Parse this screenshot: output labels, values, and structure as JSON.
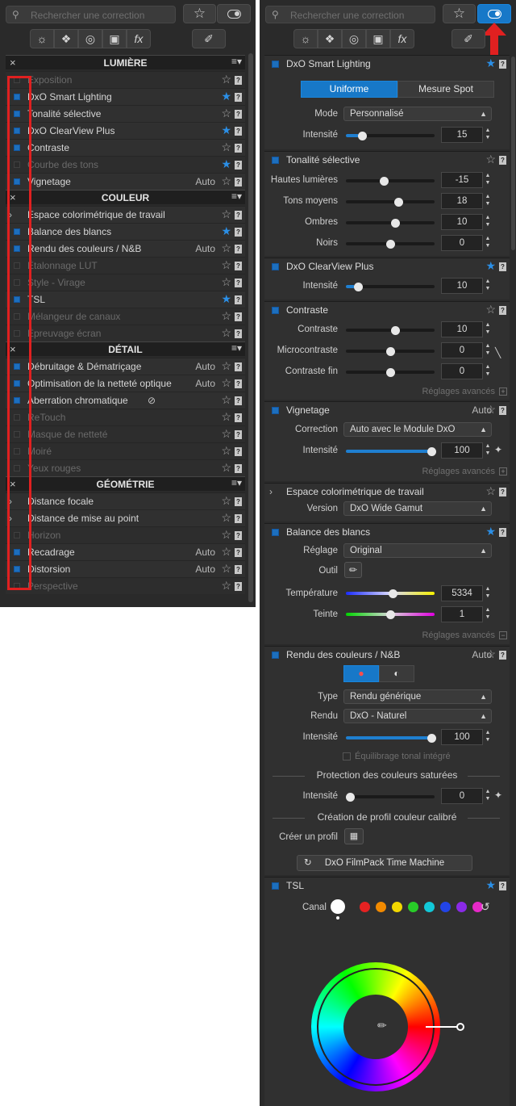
{
  "search": {
    "placeholder": "Rechercher une correction"
  },
  "left": {
    "sections": [
      {
        "title": "LUMIÈRE",
        "items": [
          {
            "label": "Exposition",
            "enabled": false,
            "star": false
          },
          {
            "label": "DxO Smart Lighting",
            "enabled": true,
            "star": true
          },
          {
            "label": "Tonalité sélective",
            "enabled": true,
            "star": false
          },
          {
            "label": "DxO ClearView Plus",
            "enabled": true,
            "star": true
          },
          {
            "label": "Contraste",
            "enabled": true,
            "star": false
          },
          {
            "label": "Courbe des tons",
            "enabled": false,
            "star": true
          },
          {
            "label": "Vignetage",
            "enabled": true,
            "star": false,
            "auto": "Auto"
          }
        ]
      },
      {
        "title": "COULEUR",
        "items": [
          {
            "label": "Espace colorimétrique de travail",
            "enabled": true,
            "star": false,
            "arrow": true
          },
          {
            "label": "Balance des blancs",
            "enabled": true,
            "star": true
          },
          {
            "label": "Rendu des couleurs / N&B",
            "enabled": true,
            "star": false,
            "auto": "Auto"
          },
          {
            "label": "Étalonnage LUT",
            "enabled": false,
            "star": false
          },
          {
            "label": "Style - Virage",
            "enabled": false,
            "star": false
          },
          {
            "label": "TSL",
            "enabled": true,
            "star": true
          },
          {
            "label": "Mélangeur de canaux",
            "enabled": false,
            "star": false
          },
          {
            "label": "Épreuvage écran",
            "enabled": false,
            "star": false
          }
        ]
      },
      {
        "title": "DÉTAIL",
        "items": [
          {
            "label": "Débruitage & Dématriçage",
            "enabled": true,
            "star": false,
            "auto": "Auto"
          },
          {
            "label": "Optimisation de la netteté optique",
            "enabled": true,
            "star": false,
            "auto": "Auto"
          },
          {
            "label": "Aberration chromatique",
            "enabled": true,
            "star": false,
            "eye": true
          },
          {
            "label": "ReTouch",
            "enabled": false,
            "star": false
          },
          {
            "label": "Masque de netteté",
            "enabled": false,
            "star": false
          },
          {
            "label": "Moiré",
            "enabled": false,
            "star": false
          },
          {
            "label": "Yeux rouges",
            "enabled": false,
            "star": false
          }
        ]
      },
      {
        "title": "GÉOMÉTRIE",
        "items": [
          {
            "label": "Distance focale",
            "enabled": true,
            "star": false,
            "arrow": true
          },
          {
            "label": "Distance de mise au point",
            "enabled": true,
            "star": false,
            "arrow": true
          },
          {
            "label": "Horizon",
            "enabled": false,
            "star": false
          },
          {
            "label": "Recadrage",
            "enabled": true,
            "star": false,
            "auto": "Auto"
          },
          {
            "label": "Distorsion",
            "enabled": true,
            "star": false,
            "auto": "Auto"
          },
          {
            "label": "Perspective",
            "enabled": false,
            "star": false
          }
        ]
      }
    ]
  },
  "toolbar": {
    "fx_label": "fx",
    "q_label": "?"
  },
  "right": {
    "smart_lighting": {
      "title": "DxO Smart Lighting",
      "seg_uniform": "Uniforme",
      "seg_spot": "Mesure Spot",
      "mode_label": "Mode",
      "mode_value": "Personnalisé",
      "intensity_label": "Intensité",
      "intensity_value": "15"
    },
    "tonal": {
      "title": "Tonalité sélective",
      "sliders": [
        {
          "label": "Hautes lumières",
          "value": "-15"
        },
        {
          "label": "Tons moyens",
          "value": "18"
        },
        {
          "label": "Ombres",
          "value": "10"
        },
        {
          "label": "Noirs",
          "value": "0"
        }
      ]
    },
    "clearview": {
      "title": "DxO ClearView Plus",
      "intensity_label": "Intensité",
      "intensity_value": "10"
    },
    "contrast": {
      "title": "Contraste",
      "sliders": [
        {
          "label": "Contraste",
          "value": "10"
        },
        {
          "label": "Microcontraste",
          "value": "0"
        },
        {
          "label": "Contraste fin",
          "value": "0"
        }
      ],
      "advanced": "Réglages avancés"
    },
    "vignetting": {
      "title": "Vignetage",
      "auto": "Auto",
      "correction_label": "Correction",
      "correction_value": "Auto avec le Module DxO",
      "intensity_label": "Intensité",
      "intensity_value": "100",
      "advanced": "Réglages avancés"
    },
    "colorspace": {
      "title": "Espace colorimétrique de travail",
      "version_label": "Version",
      "version_value": "DxO Wide Gamut"
    },
    "wb": {
      "title": "Balance des blancs",
      "setting_label": "Réglage",
      "setting_value": "Original",
      "tool_label": "Outil",
      "temp_label": "Température",
      "temp_value": "5334",
      "tint_label": "Teinte",
      "tint_value": "1",
      "advanced": "Réglages avancés"
    },
    "render": {
      "title": "Rendu des couleurs / N&B",
      "auto": "Auto",
      "type_label": "Type",
      "type_value": "Rendu générique",
      "render_label": "Rendu",
      "render_value": "DxO - Naturel",
      "intensity_label": "Intensité",
      "intensity_value": "100",
      "tonal_balance": "Équilibrage tonal intégré",
      "protection_title": "Protection des couleurs saturées",
      "protection_intensity_label": "Intensité",
      "protection_intensity_value": "0",
      "profile_title": "Création de profil couleur calibré",
      "create_profile_label": "Créer un profil",
      "filmpack_label": "DxO FilmPack Time Machine"
    },
    "hsl": {
      "title": "TSL",
      "channel_label": "Canal",
      "channels": [
        "#ffffff",
        "#e52222",
        "#f28a00",
        "#f2d800",
        "#28cc28",
        "#12c8d8",
        "#2244e6",
        "#8a2ae6",
        "#e629c8"
      ]
    }
  },
  "colors": {
    "accent": "#1778c8",
    "panel": "#2a2a2a",
    "row": "#303030",
    "highlight_red": "#e02020"
  }
}
